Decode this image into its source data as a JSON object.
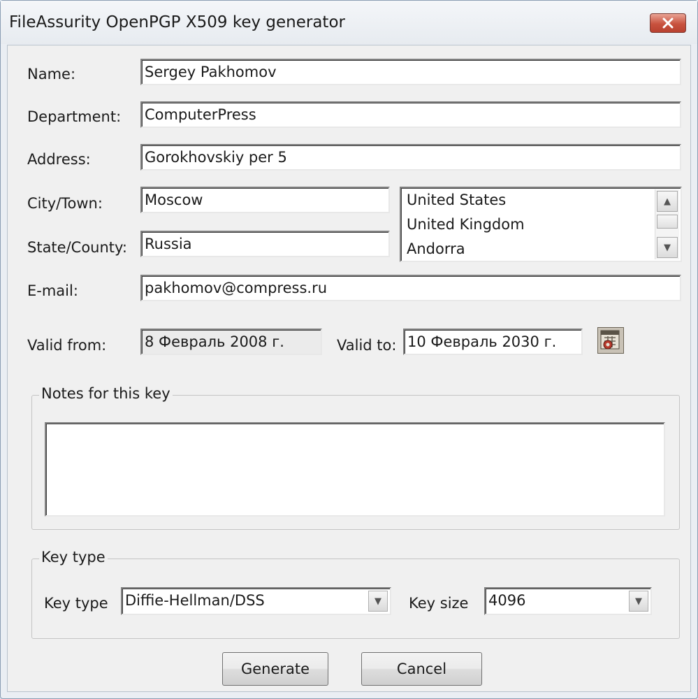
{
  "window": {
    "title": "FileAssurity OpenPGP X509 key generator"
  },
  "form": {
    "name_label": "Name:",
    "name_value": "Sergey Pakhomov",
    "department_label": "Department:",
    "department_value": "ComputerPress",
    "address_label": "Address:",
    "address_value": "Gorokhovskiy per 5",
    "city_label": "City/Town:",
    "city_value": "Moscow",
    "state_label": "State/County:",
    "state_value": "Russia",
    "email_label": "E-mail:",
    "email_value": "pakhomov@compress.ru",
    "valid_from_label": "Valid from:",
    "valid_from_value": "8 Февраль 2008 г.",
    "valid_to_label": "Valid to:",
    "valid_to_value": "10 Февраль 2030 г.",
    "calendar_icon": "calendar-icon"
  },
  "country_list": {
    "items": [
      "United States",
      "United Kingdom",
      "Andorra"
    ]
  },
  "notes": {
    "group_title": "Notes for this key",
    "value": ""
  },
  "key_type_group": {
    "group_title": "Key type",
    "key_type_label": "Key type",
    "key_type_value": "Diffie-Hellman/DSS",
    "key_size_label": "Key size",
    "key_size_value": "4096"
  },
  "buttons": {
    "generate": "Generate",
    "cancel": "Cancel"
  },
  "colors": {
    "close_button": "#c8523e",
    "dialog_bg": "#f0f0f0",
    "frame": "#dbe6f1"
  }
}
